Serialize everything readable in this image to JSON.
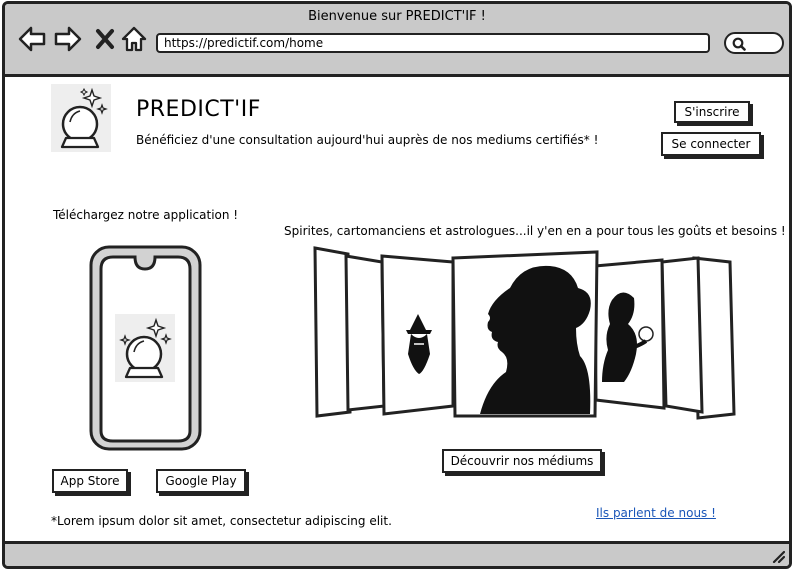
{
  "window": {
    "title": "Bienvenue sur PREDICT'IF !",
    "url": "https://predictif.com/home"
  },
  "header": {
    "brand": "PREDICT'IF",
    "tagline": "Bénéficiez d'une consultation aujourd'hui auprès de nos mediums certifiés* !",
    "signup_label": "S'inscrire",
    "login_label": "Se connecter"
  },
  "app_section": {
    "title": "Téléchargez notre application !",
    "app_store_label": "App Store",
    "google_play_label": "Google Play"
  },
  "mediums_section": {
    "title": "Spirites, cartomanciens et astrologues...il y'en en a pour tous les goûts et besoins !",
    "discover_label": "Découvrir nos médiums"
  },
  "footer": {
    "note": "*Lorem ipsum dolor sit amet, consectetur adipiscing elit.",
    "press_link": "Ils parlent de nous !"
  },
  "icons": {
    "back": "arrow-left-icon",
    "forward": "arrow-right-icon",
    "close": "close-icon",
    "home": "home-icon",
    "search": "search-icon",
    "logo": "crystal-ball-icon"
  },
  "colors": {
    "chrome": "#c9c9c9",
    "link": "#1a56b8"
  }
}
